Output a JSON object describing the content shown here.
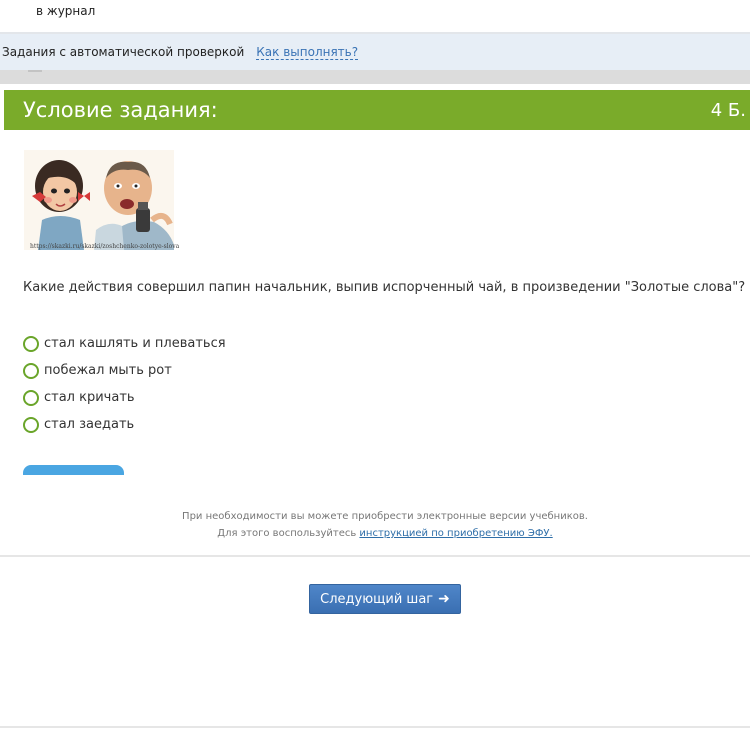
{
  "top": {
    "journal_text": "в журнал"
  },
  "auto_check_bar": {
    "label": "Задания с автоматической проверкой",
    "help_link": "Как выполнять?"
  },
  "task": {
    "header_title": "Условие задания:",
    "points": "4 Б.",
    "image_caption": "https://skazki.ru/skazki/zoshchenko-zolotye-slova",
    "question": "Какие действия совершил папин начальник, выпив испорченный чай, в произведении \"Золотые слова\"?",
    "options": [
      "стал кашлять и плеваться",
      "побежал мыть рот",
      "стал кричать",
      "стал заедать"
    ]
  },
  "footer": {
    "line1": "При необходимости вы можете приобрести электронные версии учебников.",
    "line2_prefix": "Для этого воспользуйтесь ",
    "line2_link": "инструкцией по приобретению ЭФУ."
  },
  "next_button": {
    "label": "Следующий шаг",
    "icon": "arrow-right-icon"
  },
  "colors": {
    "header_green": "#7aab2a",
    "radio_green": "#6aa52a",
    "info_bar_bg": "#e7eef6",
    "link_blue": "#3a73b5",
    "button_blue": "#3a6fb2"
  }
}
